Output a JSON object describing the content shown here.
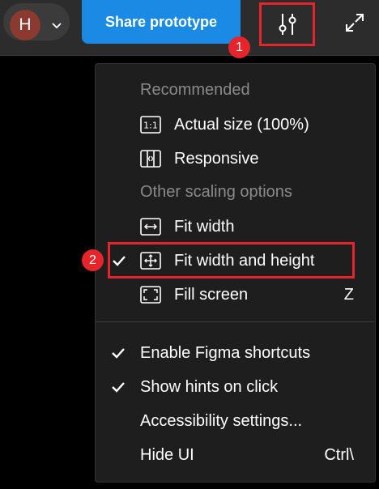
{
  "topbar": {
    "avatar_initial": "H",
    "share_label": "Share prototype",
    "settings_badge": "1"
  },
  "menu": {
    "recommended_heading": "Recommended",
    "actual_size": "Actual size (100%)",
    "responsive": "Responsive",
    "other_heading": "Other scaling options",
    "fit_width": "Fit width",
    "fit_width_height": "Fit width and height",
    "fit_width_height_badge": "2",
    "fill_screen": "Fill screen",
    "fill_screen_shortcut": "Z",
    "enable_shortcuts": "Enable Figma shortcuts",
    "show_hints": "Show hints on click",
    "accessibility": "Accessibility settings...",
    "hide_ui": "Hide UI",
    "hide_ui_shortcut": "Ctrl\\",
    "checked_items": [
      "Fit width and height",
      "Enable Figma shortcuts",
      "Show hints on click"
    ]
  },
  "colors": {
    "accent_blue": "#1a8ae5",
    "highlight_red": "#e5252b",
    "menu_bg": "#1e1e1e",
    "topbar_bg": "#2c2c2c"
  },
  "icons": {
    "settings": "sliders-icon",
    "expand": "expand-icon",
    "actual_size": "one-to-one-icon",
    "responsive": "responsive-icon",
    "fit_width": "fit-width-icon",
    "fit_width_height": "fit-width-height-icon",
    "fill_screen": "fill-screen-icon",
    "check": "check-icon",
    "chevron": "chevron-down-icon"
  }
}
